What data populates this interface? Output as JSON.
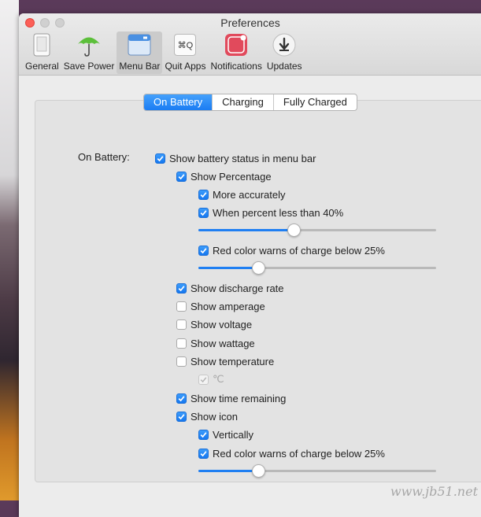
{
  "window": {
    "title": "Preferences"
  },
  "toolbar": [
    {
      "label": "General",
      "icon": "phone-icon"
    },
    {
      "label": "Save Power",
      "icon": "umbrella-icon"
    },
    {
      "label": "Menu Bar",
      "icon": "menubar-icon",
      "active": true
    },
    {
      "label": "Quit Apps",
      "icon": "command-q-icon",
      "glyph": "⌘Q"
    },
    {
      "label": "Notifications",
      "icon": "notification-badge-icon"
    },
    {
      "label": "Updates",
      "icon": "download-arrow-icon"
    }
  ],
  "tabs": [
    {
      "label": "On Battery",
      "active": true
    },
    {
      "label": "Charging"
    },
    {
      "label": "Fully Charged"
    }
  ],
  "section_label": "On Battery:",
  "options": {
    "battery_status": {
      "label": "Show battery status in menu bar",
      "checked": true
    },
    "percentage": {
      "label": "Show Percentage",
      "checked": true
    },
    "more_accurately": {
      "label": "More accurately",
      "checked": true
    },
    "percent_less": {
      "label": "When percent less than 40%",
      "checked": true
    },
    "red_warn_1": {
      "label": "Red color warns of charge below 25%",
      "checked": true
    },
    "discharge_rate": {
      "label": "Show discharge rate",
      "checked": true
    },
    "amperage": {
      "label": "Show amperage",
      "checked": false
    },
    "voltage": {
      "label": "Show voltage",
      "checked": false
    },
    "wattage": {
      "label": "Show wattage",
      "checked": false
    },
    "temperature": {
      "label": "Show temperature",
      "checked": false
    },
    "celsius": {
      "label": "℃",
      "checked": true,
      "disabled": true
    },
    "time_remaining": {
      "label": "Show time remaining",
      "checked": true
    },
    "show_icon": {
      "label": "Show icon",
      "checked": true
    },
    "vertically": {
      "label": "Vertically",
      "checked": true
    },
    "red_warn_2": {
      "label": "Red color warns of charge below 25%",
      "checked": true
    }
  },
  "sliders": {
    "percent_threshold": {
      "value": 40
    },
    "red_warn_1": {
      "value": 25
    },
    "red_warn_2": {
      "value": 25
    }
  },
  "watermark": "www.jb51.net",
  "colors": {
    "accent": "#1f7ff2",
    "close": "#fc5f57"
  }
}
